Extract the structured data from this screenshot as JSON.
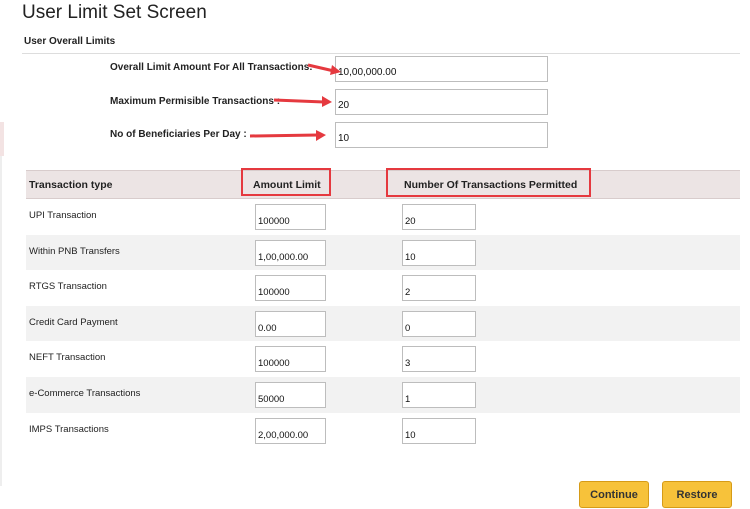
{
  "page": {
    "title": "User Limit Set Screen"
  },
  "overall": {
    "heading": "User Overall Limits",
    "fields": [
      {
        "label": "Overall Limit Amount For All Transactions:",
        "value": "10,00,000.00"
      },
      {
        "label": "Maximum Permisible Transactions :",
        "value": "20"
      },
      {
        "label": "No of Beneficiaries Per Day :",
        "value": "10"
      }
    ]
  },
  "table": {
    "headers": [
      "Transaction type",
      "Amount Limit",
      "Number Of Transactions Permitted"
    ],
    "rows": [
      {
        "type": "UPI Transaction",
        "amount": "100000",
        "count": "20"
      },
      {
        "type": "Within PNB Transfers",
        "amount": "1,00,000.00",
        "count": "10"
      },
      {
        "type": "RTGS Transaction",
        "amount": "100000",
        "count": "2"
      },
      {
        "type": "Credit Card Payment",
        "amount": "0.00",
        "count": "0"
      },
      {
        "type": "NEFT Transaction",
        "amount": "100000",
        "count": "3"
      },
      {
        "type": "e-Commerce Transactions",
        "amount": "50000",
        "count": "1"
      },
      {
        "type": "IMPS Transactions",
        "amount": "2,00,000.00",
        "count": "10"
      }
    ]
  },
  "buttons": {
    "continue": "Continue",
    "restore": "Restore"
  },
  "colors": {
    "annotation": "#e5393f",
    "button": "#f7c23a",
    "header_bg": "#ece4e4"
  }
}
